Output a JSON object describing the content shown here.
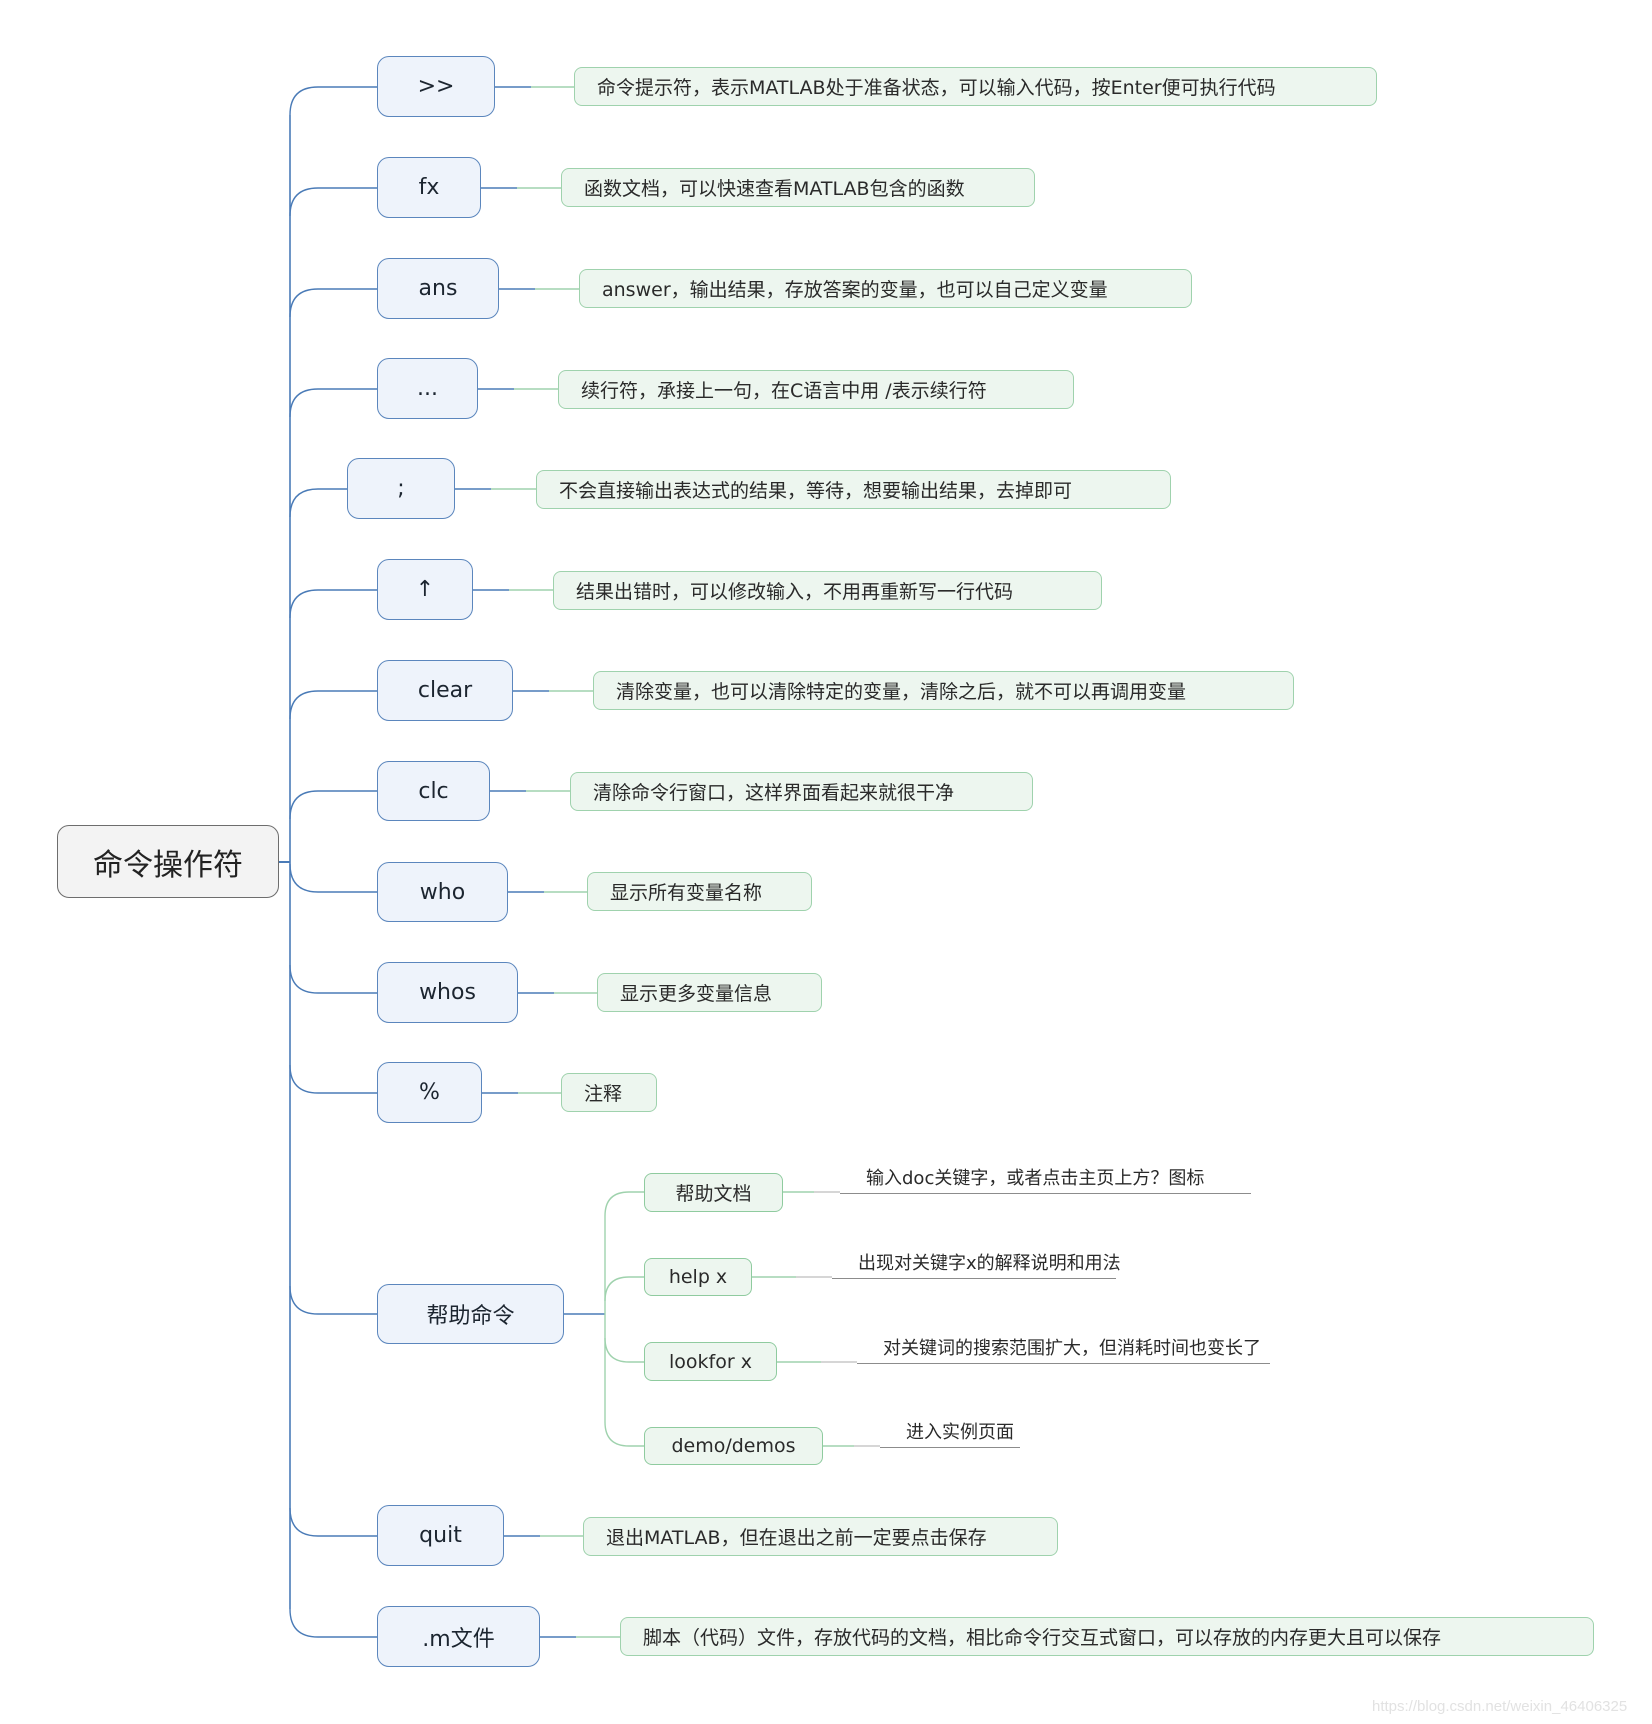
{
  "root": {
    "label": "命令操作符"
  },
  "branches": [
    {
      "id": "prompt",
      "label": ">>",
      "desc": "命令提示符，表示MATLAB处于准备状态，可以输入代码，按Enter便可执行代码"
    },
    {
      "id": "fx",
      "label": "fx",
      "desc": "函数文档，可以快速查看MATLAB包含的函数"
    },
    {
      "id": "ans",
      "label": "ans",
      "desc": "answer，输出结果，存放答案的变量，也可以自己定义变量"
    },
    {
      "id": "ellipsis",
      "label": "...",
      "desc": "续行符，承接上一句，在C语言中用 /表示续行符"
    },
    {
      "id": "semicolon",
      "label": ";",
      "desc": "不会直接输出表达式的结果，等待，想要输出结果，去掉即可"
    },
    {
      "id": "up-arrow",
      "label": "↑",
      "desc": "结果出错时，可以修改输入，不用再重新写一行代码"
    },
    {
      "id": "clear",
      "label": "clear",
      "desc": "清除变量，也可以清除特定的变量，清除之后，就不可以再调用变量"
    },
    {
      "id": "clc",
      "label": "clc",
      "desc": "清除命令行窗口，这样界面看起来就很干净"
    },
    {
      "id": "who",
      "label": "who",
      "desc": "显示所有变量名称"
    },
    {
      "id": "whos",
      "label": "whos",
      "desc": "显示更多变量信息"
    },
    {
      "id": "percent",
      "label": "%",
      "desc": "注释"
    },
    {
      "id": "help",
      "label": "帮助命令",
      "children": [
        {
          "label": "帮助文档",
          "note": "输入doc关键字，或者点击主页上方？图标"
        },
        {
          "label": "help x",
          "note": "出现对关键字x的解释说明和用法"
        },
        {
          "label": "lookfor x",
          "note": "对关键词的搜索范围扩大，但消耗时间也变长了"
        },
        {
          "label": "demo/demos",
          "note": "进入实例页面"
        }
      ]
    },
    {
      "id": "quit",
      "label": "quit",
      "desc": "退出MATLAB，但在退出之前一定要点击保存"
    },
    {
      "id": "m-file",
      "label": ".m文件",
      "desc": "脚本（代码）文件，存放代码的文档，相比命令行交互式窗口，可以存放的内存更大且可以保存"
    }
  ],
  "watermark": "https://blog.csdn.net/weixin_46406325",
  "colors": {
    "trunk": "#4a7bb7",
    "branch_green": "#9fd2ad",
    "root_border": "#6d6d6d"
  }
}
